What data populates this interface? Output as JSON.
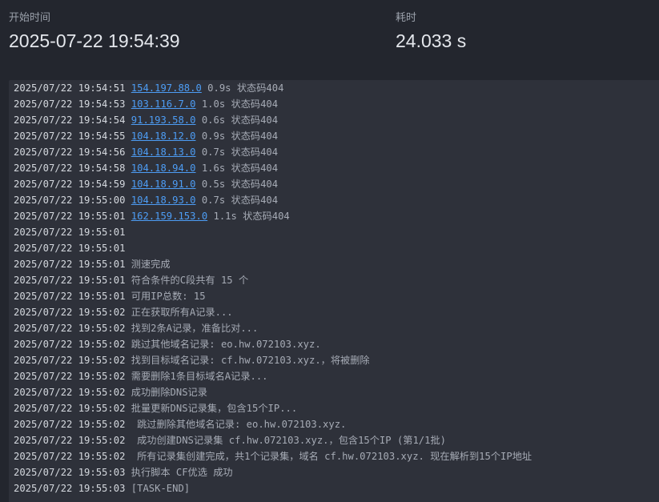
{
  "stats": {
    "start_label": "开始时间",
    "start_value": "2025-07-22 19:54:39",
    "duration_label": "耗时",
    "duration_value": "24.033 s"
  },
  "log": [
    {
      "ts": "2025/07/22 19:54:51",
      "ip": "154.197.88.0",
      "msg": "0.9s 状态码404"
    },
    {
      "ts": "2025/07/22 19:54:53",
      "ip": "103.116.7.0",
      "msg": "1.0s 状态码404"
    },
    {
      "ts": "2025/07/22 19:54:54",
      "ip": "91.193.58.0",
      "msg": "0.6s 状态码404"
    },
    {
      "ts": "2025/07/22 19:54:55",
      "ip": "104.18.12.0",
      "msg": "0.9s 状态码404"
    },
    {
      "ts": "2025/07/22 19:54:56",
      "ip": "104.18.13.0",
      "msg": "0.7s 状态码404"
    },
    {
      "ts": "2025/07/22 19:54:58",
      "ip": "104.18.94.0",
      "msg": "1.6s 状态码404"
    },
    {
      "ts": "2025/07/22 19:54:59",
      "ip": "104.18.91.0",
      "msg": "0.5s 状态码404"
    },
    {
      "ts": "2025/07/22 19:55:00",
      "ip": "104.18.93.0",
      "msg": "0.7s 状态码404"
    },
    {
      "ts": "2025/07/22 19:55:01",
      "ip": "162.159.153.0",
      "msg": "1.1s 状态码404"
    },
    {
      "ts": "2025/07/22 19:55:01",
      "ip": "",
      "msg": ""
    },
    {
      "ts": "2025/07/22 19:55:01",
      "ip": "",
      "msg": ""
    },
    {
      "ts": "2025/07/22 19:55:01",
      "ip": "",
      "msg": "测速完成"
    },
    {
      "ts": "2025/07/22 19:55:01",
      "ip": "",
      "msg": "符合条件的C段共有 15 个"
    },
    {
      "ts": "2025/07/22 19:55:01",
      "ip": "",
      "msg": "可用IP总数: 15"
    },
    {
      "ts": "2025/07/22 19:55:02",
      "ip": "",
      "msg": "正在获取所有A记录..."
    },
    {
      "ts": "2025/07/22 19:55:02",
      "ip": "",
      "msg": "找到2条A记录，准备比对..."
    },
    {
      "ts": "2025/07/22 19:55:02",
      "ip": "",
      "msg": "跳过其他域名记录: eo.hw.072103.xyz."
    },
    {
      "ts": "2025/07/22 19:55:02",
      "ip": "",
      "msg": "找到目标域名记录: cf.hw.072103.xyz.，将被删除"
    },
    {
      "ts": "2025/07/22 19:55:02",
      "ip": "",
      "msg": "需要删除1条目标域名A记录..."
    },
    {
      "ts": "2025/07/22 19:55:02",
      "ip": "",
      "msg": "成功删除DNS记录"
    },
    {
      "ts": "2025/07/22 19:55:02",
      "ip": "",
      "msg": "批量更新DNS记录集，包含15个IP..."
    },
    {
      "ts": "2025/07/22 19:55:02",
      "ip": "",
      "msg": " 跳过删除其他域名记录: eo.hw.072103.xyz."
    },
    {
      "ts": "2025/07/22 19:55:02",
      "ip": "",
      "msg": " 成功创建DNS记录集 cf.hw.072103.xyz.，包含15个IP (第1/1批)"
    },
    {
      "ts": "2025/07/22 19:55:02",
      "ip": "",
      "msg": " 所有记录集创建完成，共1个记录集，域名 cf.hw.072103.xyz. 现在解析到15个IP地址"
    },
    {
      "ts": "2025/07/22 19:55:03",
      "ip": "",
      "msg": "执行脚本 CF优选 成功"
    },
    {
      "ts": "2025/07/22 19:55:03",
      "ip": "",
      "msg": "[TASK-END]"
    }
  ]
}
